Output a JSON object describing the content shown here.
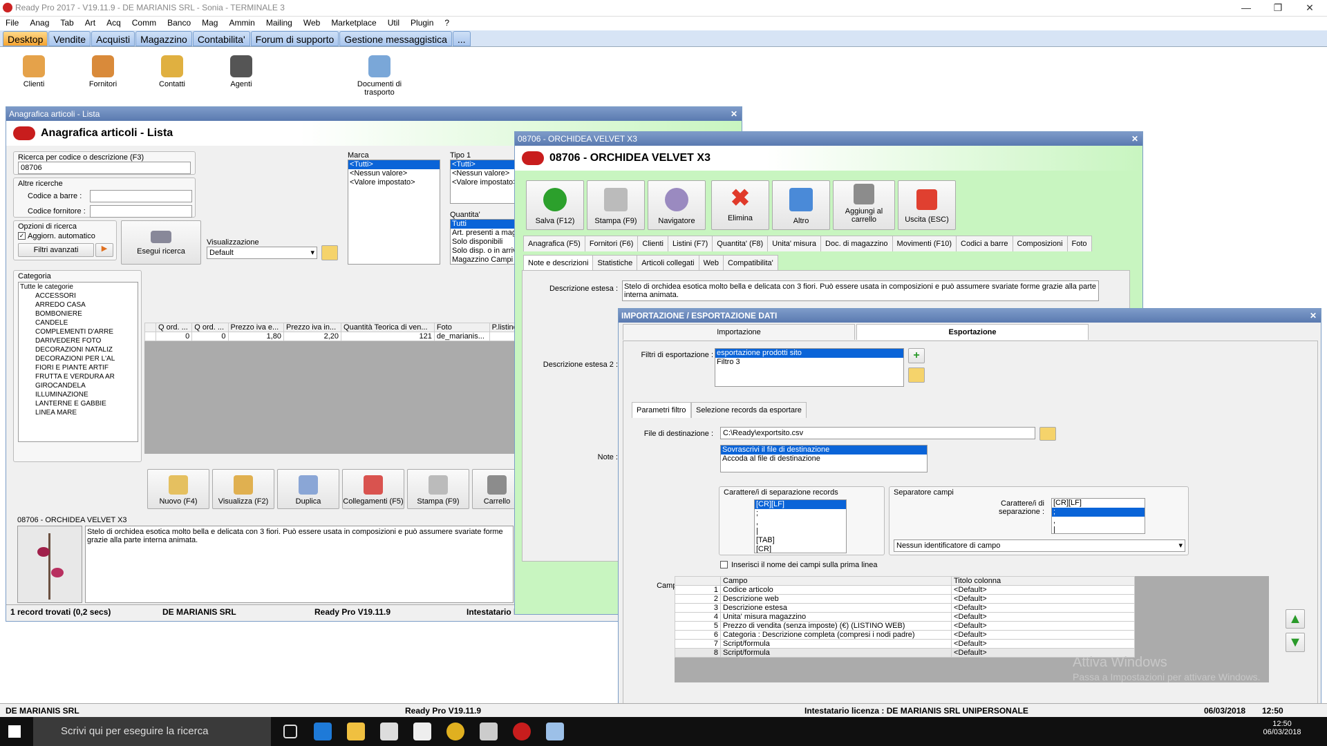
{
  "app": {
    "title": "Ready Pro 2017 - V19.11.9 - DE MARIANIS SRL - Sonia - TERMINALE 3"
  },
  "menu": [
    "File",
    "Anag",
    "Tab",
    "Art",
    "Acq",
    "Comm",
    "Banco",
    "Mag",
    "Ammin",
    "Mailing",
    "Web",
    "Marketplace",
    "Util",
    "Plugin",
    "?"
  ],
  "tabs": [
    "Desktop",
    "Vendite",
    "Acquisti",
    "Magazzino",
    "Contabilita'",
    "Forum di supporto",
    "Gestione messaggistica",
    "..."
  ],
  "desktop_icons": [
    "Clienti",
    "Fornitori",
    "Contatti",
    "Agenti",
    "Documenti di trasporto"
  ],
  "lista": {
    "window_title": "Anagrafica articoli  - Lista",
    "header": "Anagrafica articoli  - Lista",
    "search_label": "Ricerca per codice o descrizione (F3)",
    "search_value": "08706",
    "altre_ricerche": "Altre ricerche",
    "barcode_label": "Codice a barre :",
    "supplier_code_label": "Codice fornitore :",
    "opzioni": "Opzioni di ricerca",
    "auto_update": "Aggiorn. automatico",
    "adv_filters": "Filtri avanzati",
    "exec_search": "Esegui ricerca",
    "visual_label": "Visualizzazione",
    "visual_value": "Default",
    "marca_label": "Marca",
    "marca_items": [
      "<Tutti>",
      "<Nessun valore>",
      "<Valore impostato>"
    ],
    "tipo_label": "Tipo 1",
    "tipo_items": [
      "<Tutti>",
      "<Nessun valore>",
      "<Valore impostato>"
    ],
    "qty_label": "Quantita'",
    "qty_items": [
      "Tutti",
      "Art. presenti a mag",
      "Solo disponibili",
      "Solo disp. o in arrivo",
      "Magazzino Campi"
    ],
    "category_label": "Categoria",
    "categories": [
      "Tutte le categorie",
      "ACCESSORI",
      "ARREDO CASA",
      "BOMBONIERE",
      "CANDELE",
      "COMPLEMENTI D'ARRE",
      "DARIVEDERE FOTO",
      "DECORAZIONI NATALIZ",
      "DECORAZIONI PER L'AL",
      "FIORI E PIANTE ARTIF",
      "FRUTTA E VERDURA AR",
      "GIROCANDELA",
      "ILLUMINAZIONE",
      "LANTERNE E GABBIE",
      "LINEA MARE"
    ],
    "grid_headers": [
      "Q ord. ...",
      "Q ord. ...",
      "Prezzo iva e...",
      "Prezzo iva in...",
      "Quantità Teorica di ven...",
      "Foto",
      "P.listino"
    ],
    "grid_row": [
      "0",
      "0",
      "1,80",
      "2,20",
      "121",
      "de_marianis...",
      ""
    ],
    "buttons": [
      "Nuovo (F4)",
      "Visualizza (F2)",
      "Duplica",
      "Collegamenti (F5)",
      "Stampa (F9)",
      "Carrello"
    ],
    "preview_title": "08706 - ORCHIDEA VELVET X3",
    "preview_text": "Stelo di orchidea esotica molto bella e delicata con 3 fiori. Può essere usata in composizioni  e può assumere svariate forme grazie alla parte interna animata.",
    "status": [
      "1 record trovati (0,2 secs)",
      "DE MARIANIS SRL",
      "Ready Pro V19.11.9",
      "Intestatario licenza : DE MARIANIS SR"
    ]
  },
  "articolo": {
    "window_title": "08706 - ORCHIDEA VELVET X3",
    "header": "08706 - ORCHIDEA VELVET X3",
    "buttons": [
      "Salva (F12)",
      "Stampa (F9)",
      "Navigatore",
      "Elimina",
      "Altro",
      "Aggiungi al carrello",
      "Uscita (ESC)"
    ],
    "tabs1": [
      "Anagrafica (F5)",
      "Fornitori (F6)",
      "Clienti",
      "Listini (F7)",
      "Quantita' (F8)",
      "Unita' misura",
      "Doc. di magazzino",
      "Movimenti (F10)",
      "Codici a barre",
      "Composizioni",
      "Foto"
    ],
    "tabs2": [
      "Note e descrizioni",
      "Statistiche",
      "Articoli collegati",
      "Web",
      "Compatibilita'"
    ],
    "desc_label": "Descrizione estesa :",
    "desc_value": "Stelo di orchidea esotica molto bella e delicata con 3 fiori. Può essere usata in composizioni  e può assumere svariate forme grazie alla parte interna animata.",
    "desc2_label": "Descrizione estesa 2 :",
    "note_label": "Note :"
  },
  "export": {
    "window_title": "IMPORTAZIONE / ESPORTAZIONE DATI",
    "tab_import": "Importazione",
    "tab_export": "Esportazione",
    "filters_label": "Filtri di esportazione :",
    "filters": [
      "esportazione prodotti sito",
      "Filtro 3"
    ],
    "subtab1": "Parametri filtro",
    "subtab2": "Selezione records da esportare",
    "dest_label": "File di destinazione :",
    "dest_value": "C:\\Ready\\exportsito.csv",
    "write_opts": [
      "Sovrascrivi il file di destinazione",
      "Accoda al file di destinazione"
    ],
    "rec_sep_label": "Carattere/i di separazione records",
    "rec_sep_items": [
      "[CR][LF]",
      ";",
      ",",
      "|",
      "[TAB]",
      "[CR]"
    ],
    "field_sep_group": "Separatore campi",
    "field_sep_label": "Carattere/i di separazione :",
    "field_sep_items": [
      "[CR][LF]",
      ";",
      ",",
      "|"
    ],
    "field_id": "Nessun identificatore di campo",
    "insert_names": "Inserisci il nome dei campi sulla prima linea",
    "campi_label": "Campi :",
    "col_campo": "Campo",
    "col_titolo": "Titolo colonna",
    "rows": [
      {
        "n": "1",
        "campo": "Codice articolo",
        "titolo": "<Default>"
      },
      {
        "n": "2",
        "campo": "Descrizione web",
        "titolo": "<Default>"
      },
      {
        "n": "3",
        "campo": "Descrizione estesa",
        "titolo": "<Default>"
      },
      {
        "n": "4",
        "campo": "Unita' misura magazzino",
        "titolo": "<Default>"
      },
      {
        "n": "5",
        "campo": "Prezzo di vendita (senza imposte) (€) (LISTINO WEB)",
        "titolo": "<Default>"
      },
      {
        "n": "6",
        "campo": "Categoria : Descrizione completa (compresi i nodi padre)",
        "titolo": "<Default>"
      },
      {
        "n": "7",
        "campo": "Script/formula",
        "titolo": "<Default>"
      },
      {
        "n": "8",
        "campo": "Script/formula",
        "titolo": "<Default>"
      }
    ]
  },
  "watermark": {
    "line1": "Attiva Windows",
    "line2": "Passa a Impostazioni per attivare Windows."
  },
  "statusbar": {
    "company": "DE MARIANIS SRL",
    "version": "Ready Pro V19.11.9",
    "license": "Intestatario licenza : DE MARIANIS SRL UNIPERSONALE",
    "date": "06/03/2018",
    "time": "12:50"
  },
  "taskbar": {
    "search_placeholder": "Scrivi qui per eseguire la ricerca",
    "time": "12:50",
    "date": "06/03/2018"
  }
}
